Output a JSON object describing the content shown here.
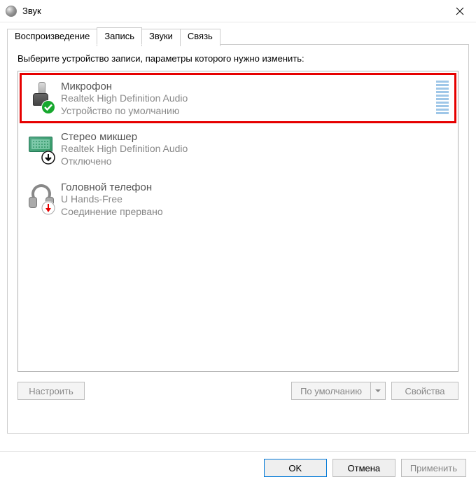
{
  "window": {
    "title": "Звук"
  },
  "tabs": [
    {
      "label": "Воспроизведение",
      "active": false
    },
    {
      "label": "Запись",
      "active": true
    },
    {
      "label": "Звуки",
      "active": false
    },
    {
      "label": "Связь",
      "active": false
    }
  ],
  "instruction": "Выберите устройство записи, параметры которого нужно изменить:",
  "devices": [
    {
      "name": "Микрофон",
      "subtitle": "Realtek High Definition Audio",
      "status": "Устройство по умолчанию",
      "icon_type": "microphone",
      "badge": "check-green",
      "highlighted": true,
      "show_meter": true
    },
    {
      "name": "Стерео микшер",
      "subtitle": "Realtek High Definition Audio",
      "status": "Отключено",
      "icon_type": "mixer",
      "badge": "arrow-down-black",
      "highlighted": false,
      "show_meter": false
    },
    {
      "name": "Головной телефон",
      "subtitle": "U Hands-Free",
      "status": "Соединение прервано",
      "icon_type": "headset",
      "badge": "arrow-down-red",
      "highlighted": false,
      "show_meter": false
    }
  ],
  "panel_buttons": {
    "configure": "Настроить",
    "default": "По умолчанию",
    "properties": "Свойства"
  },
  "dialog_buttons": {
    "ok": "OK",
    "cancel": "Отмена",
    "apply": "Применить"
  }
}
